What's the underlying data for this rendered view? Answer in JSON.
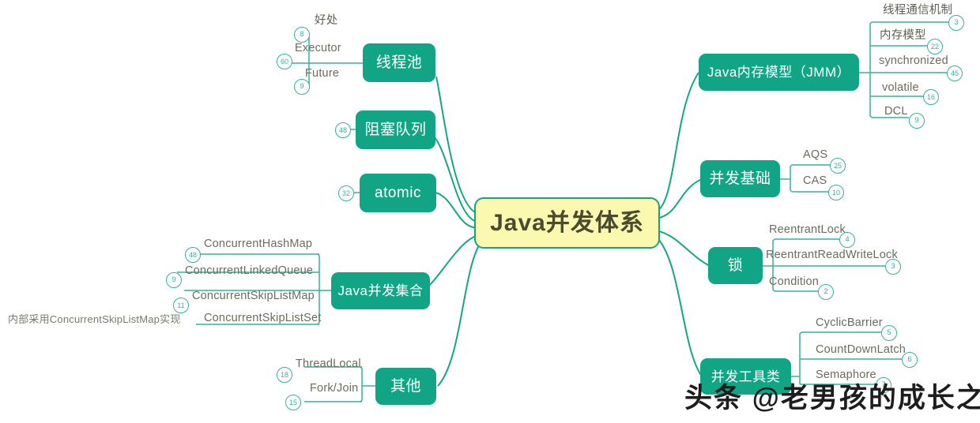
{
  "meta": {
    "accent_teal": "#12a585",
    "line_teal": "#35b29a",
    "root_fill": "#fbf8b0",
    "background": "#ffffff",
    "leaf_text": "#6b6b5e"
  },
  "root": {
    "label": "Java并发体系"
  },
  "branches": [
    {
      "id": "thread-pool",
      "label": "线程池",
      "side": "left",
      "children": [
        {
          "label": "好处",
          "badge": "8"
        },
        {
          "label": "Executor",
          "badge": "60"
        },
        {
          "label": "Future",
          "badge": "9"
        }
      ]
    },
    {
      "id": "blocking-queue",
      "label": "阻塞队列",
      "side": "left",
      "badge": "48",
      "children": []
    },
    {
      "id": "atomic",
      "label": "atomic",
      "side": "left",
      "badge": "32",
      "children": []
    },
    {
      "id": "java-concurrent-collections",
      "label": "Java并发集合",
      "side": "left",
      "children": [
        {
          "label": "ConcurrentHashMap",
          "badge": "48"
        },
        {
          "label": "ConcurrentLinkedQueue",
          "badge": "9"
        },
        {
          "label": "ConcurrentSkipListMap",
          "badge": "11"
        },
        {
          "label": "ConcurrentSkipListSet",
          "badge": ""
        }
      ],
      "note": "内部采用ConcurrentSkipListMap实现"
    },
    {
      "id": "other",
      "label": "其他",
      "side": "left",
      "children": [
        {
          "label": "ThreadLocal",
          "badge": "18"
        },
        {
          "label": "Fork/Join",
          "badge": "15"
        }
      ]
    },
    {
      "id": "jmm",
      "label": "Java内存模型（JMM）",
      "side": "right",
      "children": [
        {
          "label": "线程通信机制",
          "badge": "3"
        },
        {
          "label": "内存模型",
          "badge": "22"
        },
        {
          "label": "synchronized",
          "badge": "45"
        },
        {
          "label": "volatile",
          "badge": "16"
        },
        {
          "label": "DCL",
          "badge": "9"
        }
      ]
    },
    {
      "id": "concurrency-basics",
      "label": "并发基础",
      "side": "right",
      "children": [
        {
          "label": "AQS",
          "badge": "25"
        },
        {
          "label": "CAS",
          "badge": "10"
        }
      ]
    },
    {
      "id": "locks",
      "label": "锁",
      "side": "right",
      "children": [
        {
          "label": "ReentrantLock",
          "badge": "4"
        },
        {
          "label": "ReentrantReadWriteLock",
          "badge": "3"
        },
        {
          "label": "Condition",
          "badge": "2"
        }
      ]
    },
    {
      "id": "concurrency-utils",
      "label": "并发工具类",
      "side": "right",
      "children": [
        {
          "label": "CyclicBarrier",
          "badge": "5"
        },
        {
          "label": "CountDownLatch",
          "badge": "6"
        },
        {
          "label": "Semaphore",
          "badge": "7"
        }
      ]
    }
  ],
  "watermark": {
    "text": "头条 @老男孩的成长之路"
  }
}
